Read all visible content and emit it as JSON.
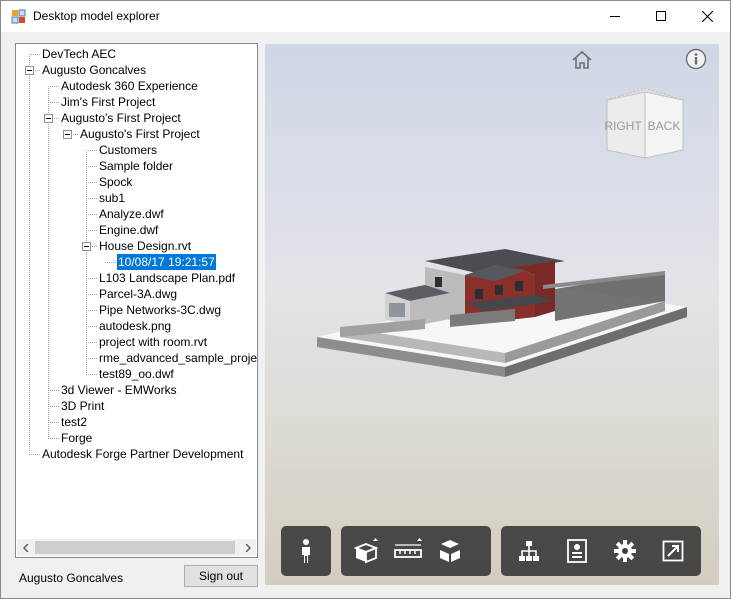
{
  "window": {
    "title": "Desktop model explorer",
    "icons": {
      "app": "app-icon",
      "minimize": "minimize-icon",
      "maximize": "maximize-icon",
      "close": "close-icon"
    }
  },
  "tree": {
    "nodes": [
      {
        "label": "DevTech AEC",
        "depth": 0
      },
      {
        "label": "Augusto Goncalves",
        "depth": 0,
        "expanded": true
      },
      {
        "label": "Autodesk 360 Experience",
        "depth": 1
      },
      {
        "label": "Jim's First Project",
        "depth": 1
      },
      {
        "label": "Augusto's First Project",
        "depth": 1,
        "expanded": true
      },
      {
        "label": "Augusto's First Project",
        "depth": 2,
        "expanded": true
      },
      {
        "label": "Customers",
        "depth": 3
      },
      {
        "label": "Sample folder",
        "depth": 3
      },
      {
        "label": "Spock",
        "depth": 3
      },
      {
        "label": "sub1",
        "depth": 3
      },
      {
        "label": "Analyze.dwf",
        "depth": 3
      },
      {
        "label": "Engine.dwf",
        "depth": 3
      },
      {
        "label": "House Design.rvt",
        "depth": 3,
        "expanded": true
      },
      {
        "label": "10/08/17 19:21:57",
        "depth": 4,
        "selected": true
      },
      {
        "label": "L103 Landscape Plan.pdf",
        "depth": 3
      },
      {
        "label": "Parcel-3A.dwg",
        "depth": 3
      },
      {
        "label": "Pipe Networks-3C.dwg",
        "depth": 3
      },
      {
        "label": "autodesk.png",
        "depth": 3
      },
      {
        "label": "project with room.rvt",
        "depth": 3
      },
      {
        "label": "rme_advanced_sample_project.rv",
        "depth": 3
      },
      {
        "label": "test89_oo.dwf",
        "depth": 3
      },
      {
        "label": "3d Viewer - EMWorks",
        "depth": 1
      },
      {
        "label": "3D Print",
        "depth": 1
      },
      {
        "label": "test2",
        "depth": 1
      },
      {
        "label": "Forge",
        "depth": 1
      },
      {
        "label": "Autodesk Forge Partner Development",
        "depth": 0
      }
    ],
    "scroll_icons": {
      "left": "scroll-left-icon",
      "right": "scroll-right-icon"
    }
  },
  "footer": {
    "user_name": "Augusto Goncalves",
    "sign_out_label": "Sign out"
  },
  "viewer": {
    "viewcube": {
      "right_label": "RIGHT",
      "back_label": "BACK"
    },
    "icons": {
      "home": "home-icon",
      "info": "info-icon"
    },
    "toolbars": [
      {
        "name": "walk",
        "tools": [
          "first-person-icon"
        ]
      },
      {
        "name": "measure",
        "tools": [
          "section-icon",
          "measure-icon",
          "explode-icon"
        ]
      },
      {
        "name": "settings",
        "tools": [
          "model-browser-icon",
          "properties-icon",
          "settings-icon",
          "fullscreen-icon"
        ]
      }
    ]
  }
}
